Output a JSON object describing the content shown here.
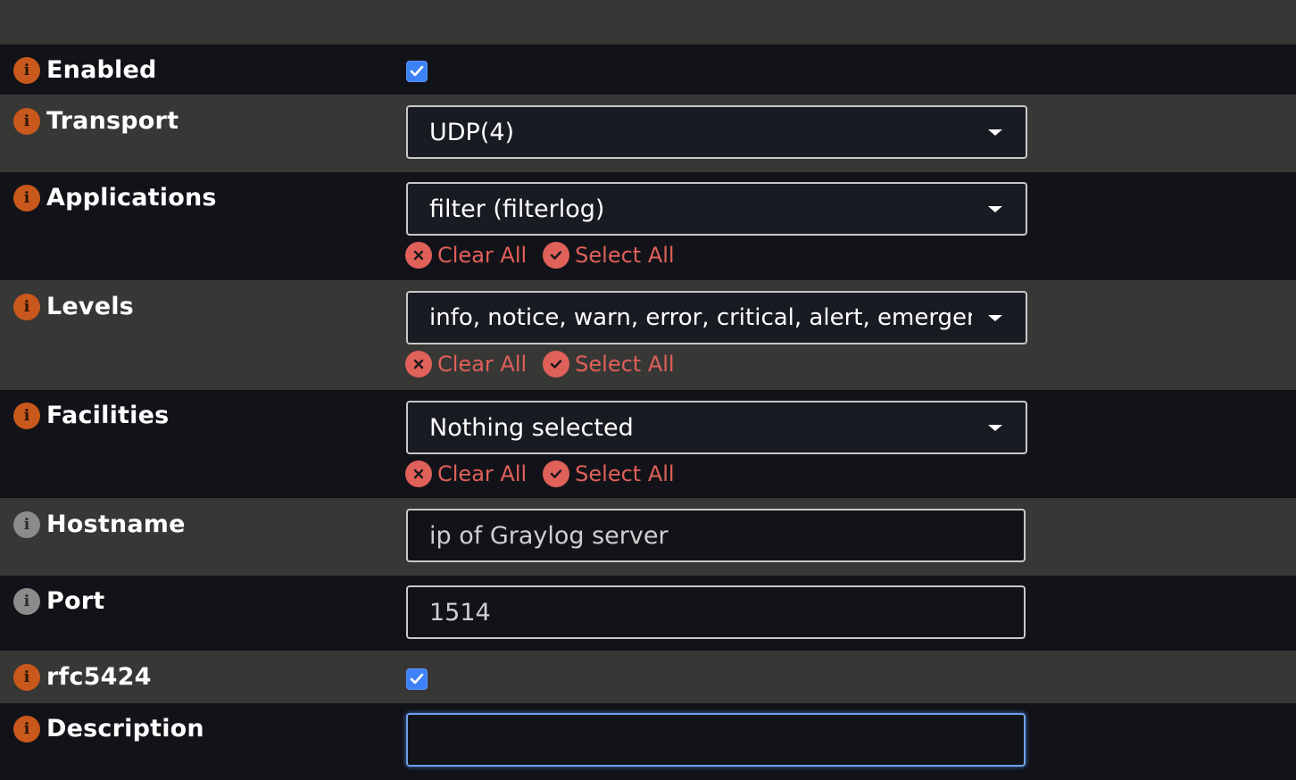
{
  "fields": {
    "enabled": {
      "label": "Enabled",
      "checked": true
    },
    "transport": {
      "label": "Transport",
      "value": "UDP(4)"
    },
    "applications": {
      "label": "Applications",
      "value": "filter (filterlog)",
      "clear_all": "Clear All",
      "select_all": "Select All"
    },
    "levels": {
      "label": "Levels",
      "value": "info, notice, warn, error, critical, alert, emergency",
      "clear_all": "Clear All",
      "select_all": "Select All"
    },
    "facilities": {
      "label": "Facilities",
      "value": "Nothing selected",
      "clear_all": "Clear All",
      "select_all": "Select All"
    },
    "hostname": {
      "label": "Hostname",
      "placeholder": "ip of Graylog server"
    },
    "port": {
      "label": "Port",
      "placeholder": "1514"
    },
    "rfc5424": {
      "label": "rfc5424",
      "checked": true
    },
    "description": {
      "label": "Description",
      "value": ""
    }
  },
  "icons": {
    "info": "info-icon",
    "clear": "x-circle-icon",
    "select": "check-circle-icon",
    "caret": "caret-down-icon",
    "check": "checkmark-icon"
  },
  "colors": {
    "info_orange": "#c8581b",
    "info_gray": "#8b8b8b",
    "action_red": "#e0605a",
    "checkbox_blue": "#3c82f6",
    "focus_blue": "#6f9fe8"
  }
}
